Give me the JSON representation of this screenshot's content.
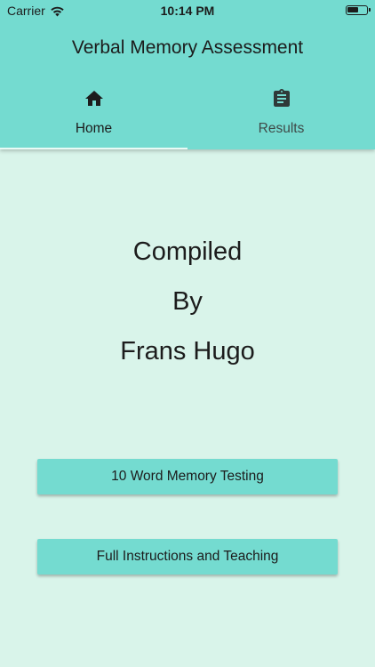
{
  "status_bar": {
    "carrier": "Carrier",
    "time": "10:14 PM"
  },
  "app": {
    "title": "Verbal Memory Assessment",
    "accent_color": "#74dbd0",
    "background_color": "#d9f4ea"
  },
  "tabs": [
    {
      "label": "Home",
      "icon": "home-icon",
      "active": true
    },
    {
      "label": "Results",
      "icon": "clipboard-icon",
      "active": false
    }
  ],
  "credit": {
    "line1": "Compiled",
    "line2": "By",
    "line3": "Frans Hugo"
  },
  "buttons": {
    "memory_testing": "10 Word Memory Testing",
    "instructions": "Full Instructions and Teaching"
  }
}
